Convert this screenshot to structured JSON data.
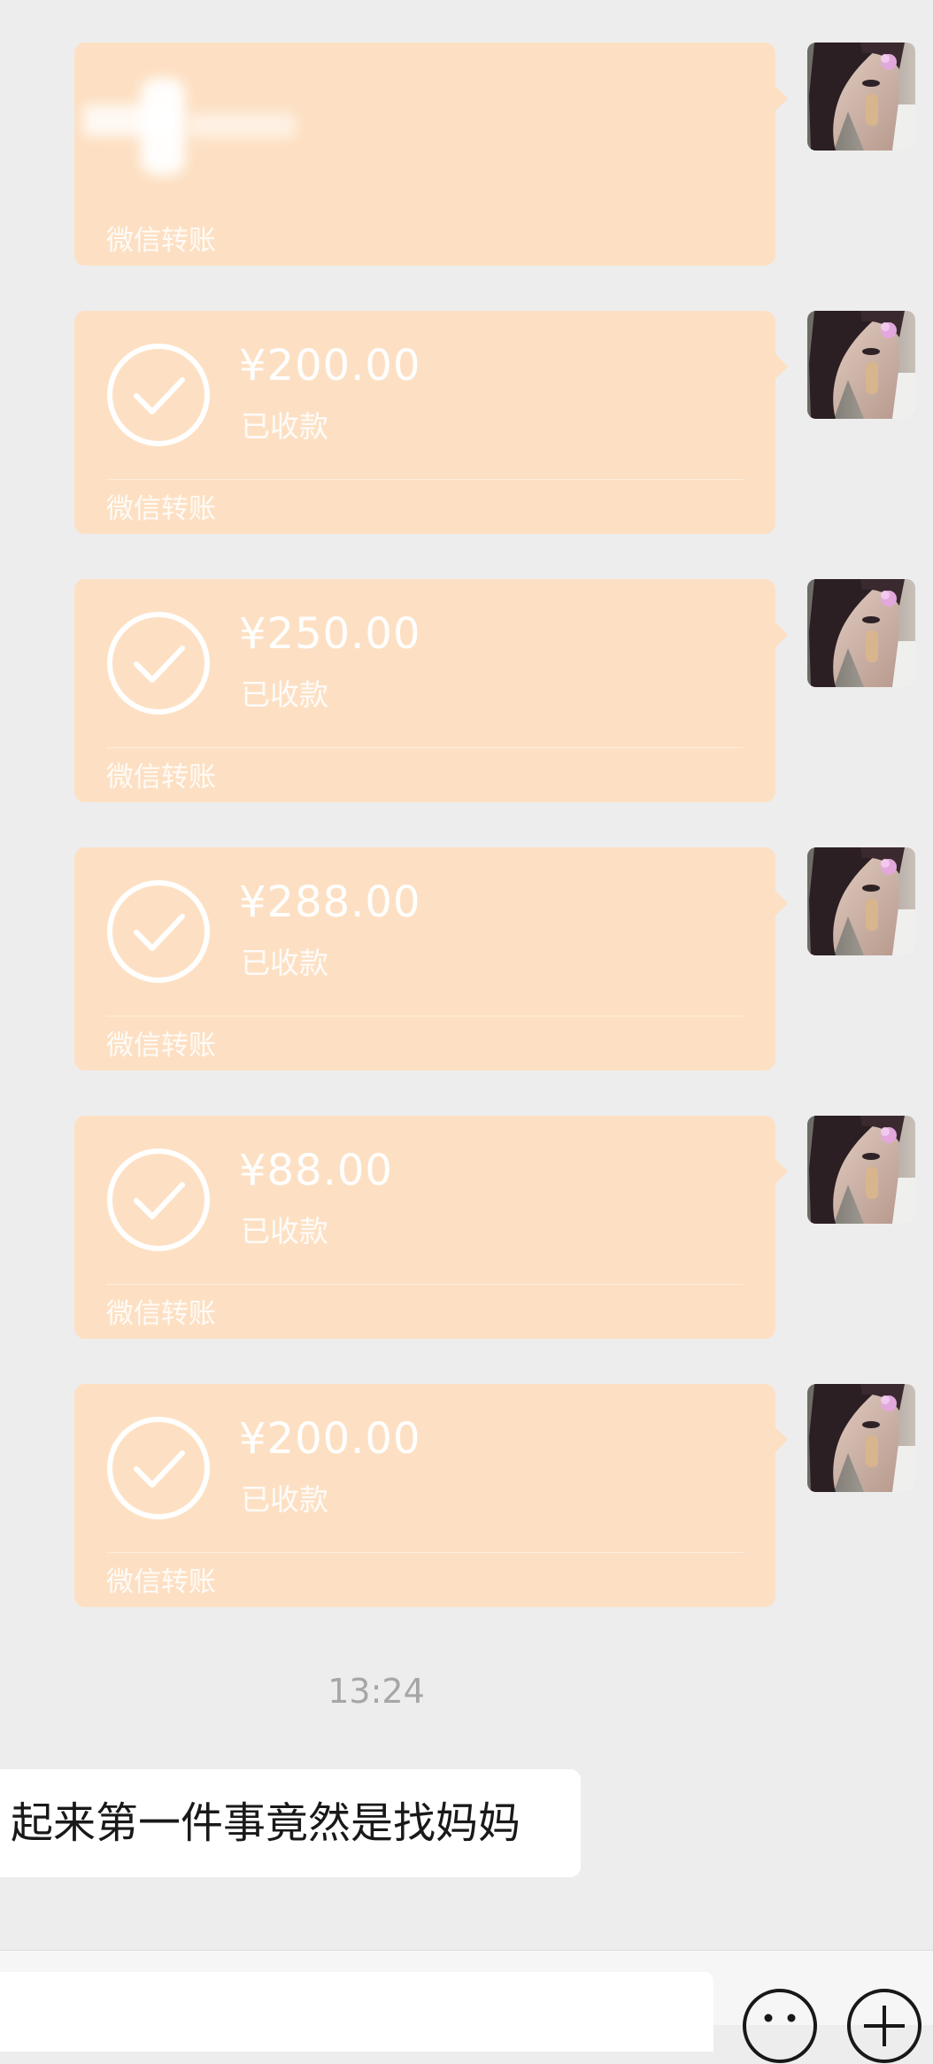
{
  "transfers": [
    {
      "amount": "",
      "status": "",
      "label": "微信转账",
      "blurred": true
    },
    {
      "amount": "¥200.00",
      "status": "已收款",
      "label": "微信转账"
    },
    {
      "amount": "¥250.00",
      "status": "已收款",
      "label": "微信转账"
    },
    {
      "amount": "¥288.00",
      "status": "已收款",
      "label": "微信转账"
    },
    {
      "amount": "¥88.00",
      "status": "已收款",
      "label": "微信转账"
    },
    {
      "amount": "¥200.00",
      "status": "已收款",
      "label": "微信转账"
    }
  ],
  "timestamp": "13:24",
  "incoming_message": "起来第一件事竟然是找妈妈",
  "icons": {
    "received": "check-circle-icon",
    "emoji": "smile-icon",
    "more": "plus-circle-icon"
  },
  "colors": {
    "chat_background": "#ededed",
    "transfer_bubble": "#fde0c3",
    "incoming_bubble": "#ffffff",
    "timestamp_text": "#a6a6a6"
  }
}
